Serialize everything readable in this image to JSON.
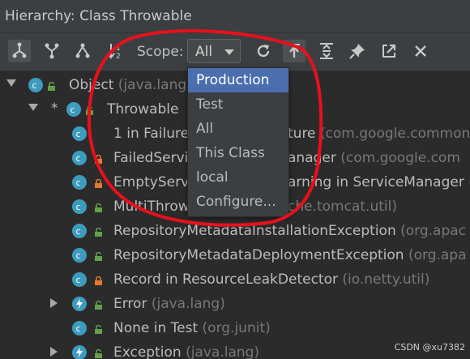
{
  "header": {
    "title": "Hierarchy:  Class Throwable"
  },
  "toolbar": {
    "scope_label": "Scope:",
    "scope_value": "All",
    "buttons": [
      "subtypes-hierarchy-icon",
      "supertypes-hierarchy-icon",
      "class-hierarchy-icon",
      "sort-alpha-icon",
      "refresh-icon",
      "scroll-to-source-icon",
      "expand-all-icon",
      "pin-icon",
      "export-icon",
      "close-icon"
    ]
  },
  "dropdown": {
    "options": [
      "Production",
      "Test",
      "All",
      "This Class",
      "local",
      "Configure..."
    ],
    "selected": "Production"
  },
  "tree": {
    "rows": [
      {
        "name": "Object",
        "pkg": " (java.lang)"
      },
      {
        "name": "Throwable",
        "pkg": ""
      },
      {
        "name": "1 in FailureO",
        "pkg": ""
      },
      {
        "name": "FailedServi",
        "pkg": ""
      },
      {
        "name": "EmptyServi",
        "pkg": ""
      },
      {
        "name": "MultiThrow",
        "pkg": ""
      },
      {
        "name": "RepositoryMetadataInstallationException",
        "pkg": " (org.apac"
      },
      {
        "name": "RepositoryMetadataDeploymentException",
        "pkg": " (org.apa"
      },
      {
        "name": "Record in ResourceLeakDetector",
        "pkg": " (io.netty.util)"
      },
      {
        "name": "Error",
        "pkg": " (java.lang)"
      },
      {
        "name": "None in Test",
        "pkg": " (org.junit)"
      },
      {
        "name": "Exception",
        "pkg": " (java.lang)"
      }
    ],
    "partial_right": [
      {
        "name": "ture",
        "pkg": " (com.google.common"
      },
      {
        "name": "anager",
        "pkg": " (com.google.com"
      },
      {
        "name": "arning in ServiceManager",
        "pkg": " ("
      },
      {
        "name": "",
        "pkg": "che.tomcat.util)"
      }
    ]
  },
  "watermark": "CSDN @xu7382",
  "colors": {
    "selection": "#4b6eaf",
    "annotation": "#e8101c",
    "lock_orange": "#e07a2e",
    "lock_green": "#62a04a"
  }
}
